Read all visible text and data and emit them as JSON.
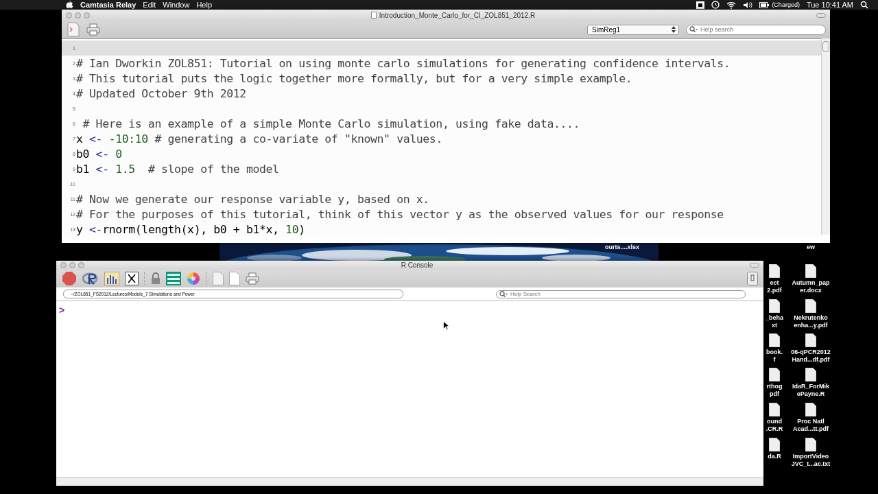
{
  "menu_bar": {
    "app": "Camtasia Relay",
    "items": [
      "Edit",
      "Window",
      "Help"
    ],
    "battery": "(Charged)",
    "clock": "Tue 10:41 AM"
  },
  "editor": {
    "title": "Introduction_Monte_Carlo_for_CI_ZOL851_2012.R",
    "function_menu": "SimReg1",
    "search": {
      "placeholder": "Help search"
    },
    "lines": [
      {
        "number": "1",
        "current": true
      },
      {
        "number": "2",
        "current": false,
        "parts": [
          {
            "kind": "comment",
            "text": "# Ian Dworkin ZOL851: Tutorial on using monte carlo simulations for generating confidence intervals."
          }
        ]
      },
      {
        "number": "3",
        "current": false,
        "parts": [
          {
            "kind": "comment",
            "text": "# This tutorial puts the logic together more formally, but for a very simple example."
          }
        ]
      },
      {
        "number": "4",
        "current": false,
        "parts": [
          {
            "kind": "comment",
            "text": "# Updated October 9th 2012"
          }
        ]
      },
      {
        "number": "5",
        "current": false
      },
      {
        "number": "6",
        "current": false,
        "parts": [
          {
            "kind": "comment",
            "text": " # Here is an example of a simple Monte Carlo simulation, using fake data...."
          }
        ]
      },
      {
        "number": "7",
        "current": false,
        "parts": [
          {
            "kind": "plain",
            "text": "x "
          },
          {
            "kind": "operator",
            "text": "<- "
          },
          {
            "kind": "number",
            "text": "-10:10"
          },
          {
            "kind": "comment",
            "text": " # generating a co-variate of \"known\" values."
          }
        ]
      },
      {
        "number": "8",
        "current": false,
        "parts": [
          {
            "kind": "plain",
            "text": "b0 "
          },
          {
            "kind": "operator",
            "text": "<- "
          },
          {
            "kind": "number",
            "text": "0"
          }
        ]
      },
      {
        "number": "9",
        "current": false,
        "parts": [
          {
            "kind": "plain",
            "text": "b1 "
          },
          {
            "kind": "operator",
            "text": "<- "
          },
          {
            "kind": "number",
            "text": "1.5"
          },
          {
            "kind": "comment",
            "text": "  # slope of the model"
          }
        ]
      },
      {
        "number": "10",
        "current": false
      },
      {
        "number": "11",
        "current": false,
        "parts": [
          {
            "kind": "comment",
            "text": "# Now we generate our response variable y, based on x."
          }
        ]
      },
      {
        "number": "12",
        "current": false,
        "parts": [
          {
            "kind": "comment",
            "text": "# For the purposes of this tutorial, think of this vector y as the observed values for our response"
          }
        ]
      },
      {
        "number": "13",
        "current": false,
        "parts": [
          {
            "kind": "plain",
            "text": "y "
          },
          {
            "kind": "operator",
            "text": "<-"
          },
          {
            "kind": "function",
            "text": "rnorm(length(x), b0 + b1*x, "
          },
          {
            "kind": "number",
            "text": "10"
          },
          {
            "kind": "function",
            "text": ")"
          }
        ]
      }
    ]
  },
  "console": {
    "title": "R Console",
    "path": "~/ZOL851_FS2012/Lectures/Module_7 Simulations and Power",
    "search": {
      "placeholder": "Help Search"
    },
    "prompt": ">"
  },
  "desktop_icons": [
    {
      "lines": [
        "ourts....xlsx"
      ]
    },
    {
      "lines": [
        "ew"
      ]
    },
    {
      "lines": [
        "ect",
        "2.pdf"
      ]
    },
    {
      "lines": [
        "Autumn_pap",
        "er.docx"
      ]
    },
    {
      "lines": [
        "_beha",
        "xt"
      ]
    },
    {
      "lines": [
        "Nekrutenko",
        "enha...y.pdf"
      ]
    },
    {
      "lines": [
        "book.",
        "f"
      ]
    },
    {
      "lines": [
        "06-qPCR2012",
        "Hand...df.pdf"
      ]
    },
    {
      "lines": [
        "rthog",
        "pdf"
      ]
    },
    {
      "lines": [
        "IdaR_ForMik",
        "ePayne.R"
      ]
    },
    {
      "lines": [
        "ound",
        ".CR.R"
      ]
    },
    {
      "lines": [
        "Proc Natl",
        "Acad...tt.pdf"
      ]
    },
    {
      "lines": [
        "da.R"
      ]
    },
    {
      "lines": [
        "ImportVideo",
        "JVC_t...ac.txt"
      ]
    }
  ]
}
